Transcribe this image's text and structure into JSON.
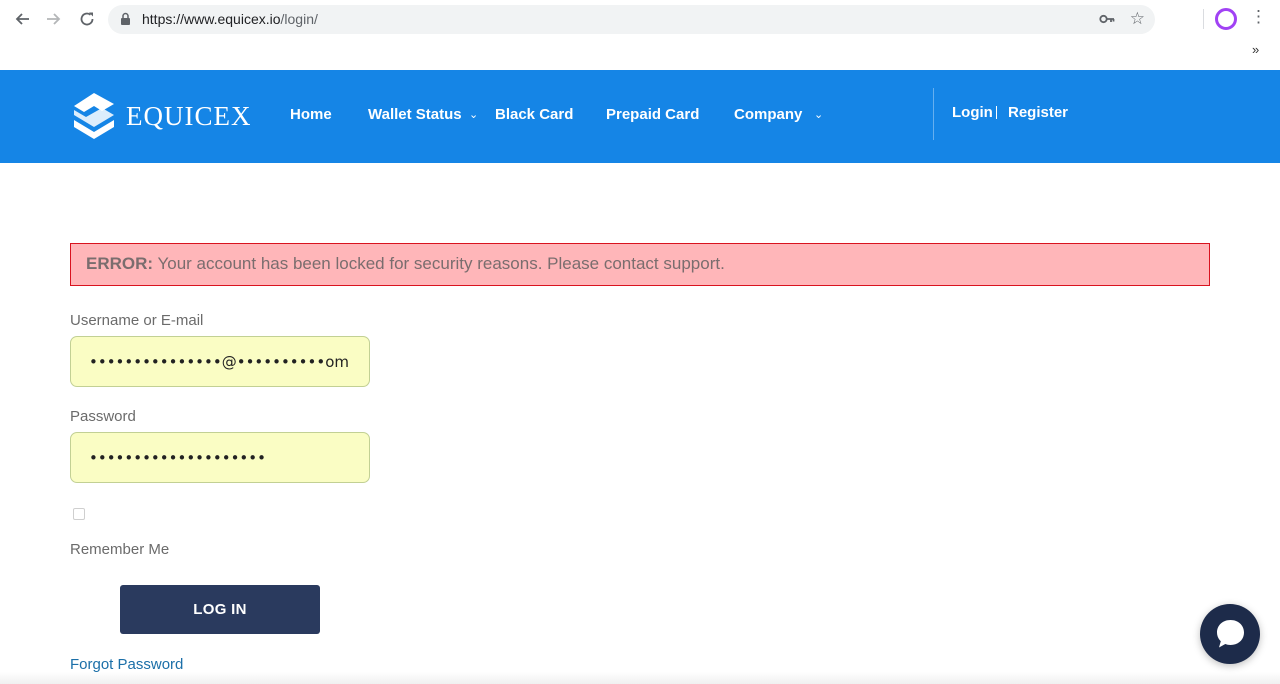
{
  "browser": {
    "url_host": "https://www.equicex.io",
    "url_path": "/login/",
    "back_icon": "arrow-left",
    "forward_icon": "arrow-right",
    "reload_icon": "reload",
    "overflow_label": "»"
  },
  "header": {
    "logo_text": "EQUICEX",
    "nav": [
      {
        "label": "Home"
      },
      {
        "label": "Wallet Status",
        "has_dropdown": true
      },
      {
        "label": "Black Card"
      },
      {
        "label": "Prepaid Card"
      },
      {
        "label": "Company",
        "has_dropdown": true
      }
    ],
    "login_label": "Login",
    "register_label": "Register",
    "background_color": "#1585e6"
  },
  "error": {
    "prefix": "ERROR:",
    "message": " Your account has been locked for security reasons. Please contact support.",
    "background_color": "#ffb6b9",
    "border_color": "#d9131f"
  },
  "form": {
    "username_label": "Username or E-mail",
    "username_value": "•••••••••••••••@••••••••••om",
    "password_label": "Password",
    "password_value": "••••••••••••••••••••",
    "remember_label": "Remember Me",
    "remember_checked": false,
    "login_button": "LOG IN",
    "forgot_link": "Forgot Password",
    "autofill_color": "#fafdc4",
    "button_color": "#2a3a5e"
  },
  "chat": {
    "icon": "chat-bubble-icon",
    "color": "#1d2b4a"
  }
}
